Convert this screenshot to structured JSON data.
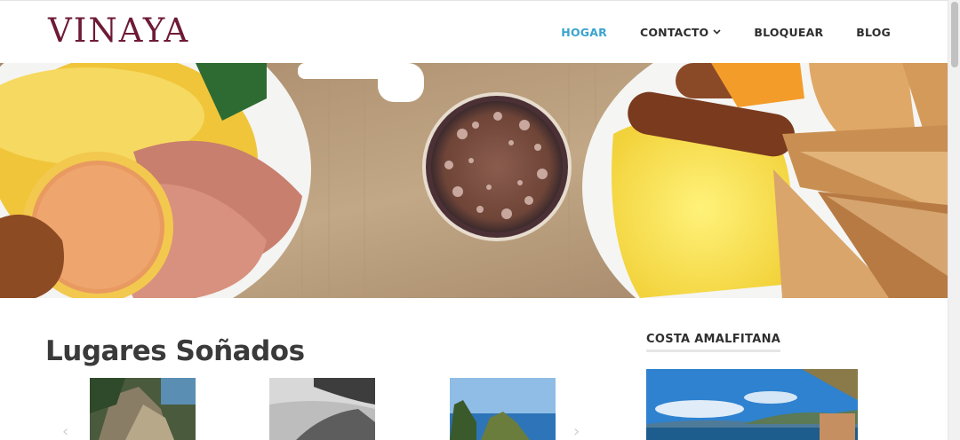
{
  "site": {
    "logo": "VINAYA"
  },
  "nav": {
    "items": [
      {
        "label": "HOGAR",
        "active": true
      },
      {
        "label": "CONTACTO",
        "dropdown": true
      },
      {
        "label": "BLOQUEAR"
      },
      {
        "label": "BLOG"
      }
    ]
  },
  "main": {
    "section_title": "Lugares Soñados"
  },
  "sidebar": {
    "widget_title": "COSTA AMALFITANA"
  },
  "colors": {
    "logo": "#6e1a36",
    "nav_active": "#3aa3cf",
    "nav_text": "#2e2e2e"
  }
}
